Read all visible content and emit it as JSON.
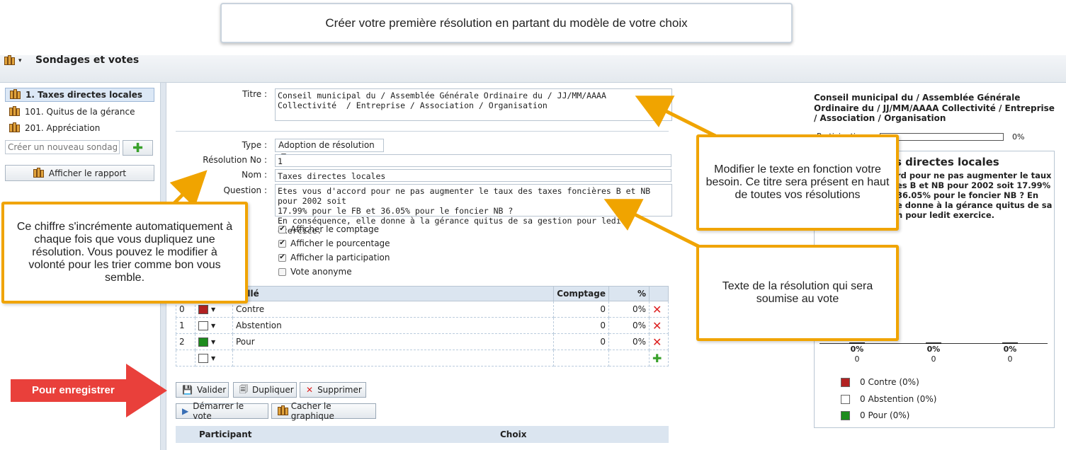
{
  "banner": "Créer votre première résolution en partant du modèle de votre choix",
  "app": {
    "title": "Sondages et votes"
  },
  "sidebar": {
    "items": [
      {
        "label": "1. Taxes directes locales",
        "selected": true
      },
      {
        "label": "101. Quitus de la gérance",
        "selected": false
      },
      {
        "label": "201. Appréciation",
        "selected": false
      }
    ],
    "new_placeholder": "Créer un nouveau sondage",
    "report_label": "Afficher le rapport"
  },
  "form": {
    "titre_label": "Titre :",
    "titre_value": "Conseil municipal du / Assemblée Générale Ordinaire du / JJ/MM/AAAA\nCollectivité  / Entreprise / Association / Organisation",
    "type_label": "Type :",
    "type_value": "Adoption de résolution",
    "resno_label": "Résolution No :",
    "resno_value": "1",
    "nom_label": "Nom :",
    "nom_value": "Taxes directes locales",
    "question_label": "Question :",
    "question_value": "Etes vous d'accord pour ne pas augmenter le taux des taxes foncières B et NB pour 2002 soit\n17.99% pour le FB et 36.05% pour le foncier NB ?\nEn conséquence, elle donne à la gérance quitus de sa gestion pour ledit exercice.",
    "options": [
      {
        "label": "Afficher le comptage",
        "checked": true
      },
      {
        "label": "Afficher le pourcentage",
        "checked": true
      },
      {
        "label": "Afficher la participation",
        "checked": true
      },
      {
        "label": "Vote anonyme",
        "checked": false
      }
    ]
  },
  "choices_table": {
    "headers": {
      "libelle": "llellé",
      "comptage": "Comptage",
      "pct": "%"
    },
    "rows": [
      {
        "idx": "0",
        "color": "#b22222",
        "label": "Contre",
        "count": "0",
        "pct": "0%"
      },
      {
        "idx": "1",
        "color": "#ffffff",
        "label": "Abstention",
        "count": "0",
        "pct": "0%"
      },
      {
        "idx": "2",
        "color": "#1e8c1e",
        "label": "Pour",
        "count": "0",
        "pct": "0%"
      }
    ]
  },
  "buttons": {
    "valider": "Valider",
    "dupliquer": "Dupliquer",
    "supprimer": "Supprimer",
    "demarrer": "Démarrer le vote",
    "cacher": "Cacher le graphique"
  },
  "participants": {
    "col1": "Participant",
    "col2": "Choix"
  },
  "preview": {
    "title": "Conseil municipal du / Assemblée Générale Ordinaire du / JJ/MM/AAAA Collectivité / Entreprise / Association / Organisation",
    "participation_label": "Participation",
    "participation_pct": "0%",
    "heading_fragment": "s directes locales",
    "question_lines": [
      "rd pour ne pas augmenter le taux",
      "es B et NB pour 2002 soit 17.99%",
      "36.05% pour le foncier NB ? En",
      "e donne à la gérance quitus de sa",
      "n pour ledit exercice."
    ],
    "bars": [
      {
        "pct": "0%",
        "count": "0"
      },
      {
        "pct": "0%",
        "count": "0"
      },
      {
        "pct": "0%",
        "count": "0"
      }
    ],
    "legend": [
      {
        "label": "0 Contre (0%)",
        "color": "#b22222"
      },
      {
        "label": "0 Abstention (0%)",
        "color": "#ffffff"
      },
      {
        "label": "0 Pour (0%)",
        "color": "#1e8c1e"
      }
    ]
  },
  "callouts": {
    "left": "Ce chiffre s'incrémente automatiquement à chaque fois que vous dupliquez une résolution. Vous pouvez le modifier à volonté pour les trier comme bon vous semble.",
    "right_top": "Modifier le texte en fonction votre besoin. Ce titre sera présent en haut de toutes vos résolutions",
    "right_bottom": "Texte de la résolution qui sera soumise au vote",
    "save": "Pour enregistrer"
  }
}
